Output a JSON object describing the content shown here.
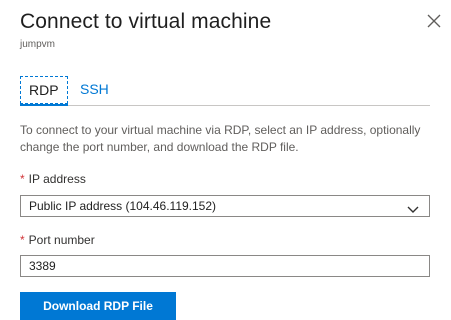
{
  "header": {
    "title": "Connect to virtual machine",
    "subtitle": "jumpvm",
    "close_icon": "close-icon"
  },
  "tabs": [
    {
      "label": "RDP",
      "selected": true
    },
    {
      "label": "SSH",
      "selected": false
    }
  ],
  "description": "To connect to your virtual machine via RDP, select an IP address, optionally change the port number, and download the RDP file.",
  "ip_field": {
    "required_marker": "*",
    "label": "IP address",
    "value": "Public IP address (104.46.119.152)",
    "icon": "chevron-down-icon"
  },
  "port_field": {
    "required_marker": "*",
    "label": "Port number",
    "value": "3389"
  },
  "download_button": {
    "label": "Download RDP File"
  },
  "colors": {
    "accent": "#0078d4",
    "required": "#d13438",
    "border": "#8a8886"
  }
}
